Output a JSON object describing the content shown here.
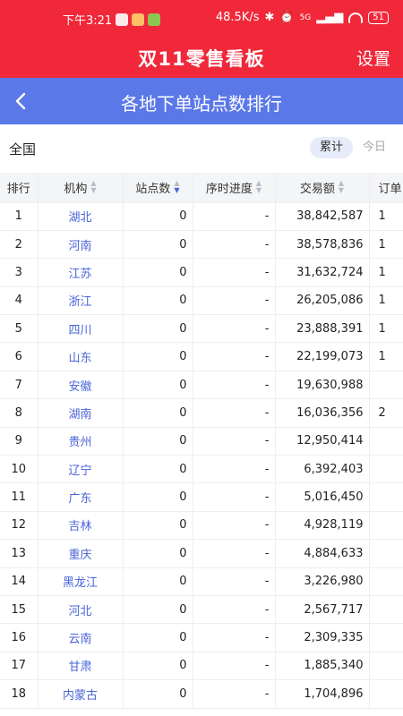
{
  "status_bar": {
    "time": "下午3:21",
    "speed": "48.5K/s",
    "signal": "5G",
    "battery": "51"
  },
  "header": {
    "title": "双11零售看板",
    "settings_label": "设置"
  },
  "subheader": {
    "title": "各地下单站点数排行"
  },
  "filter": {
    "region": "全国",
    "cumulative_label": "累计",
    "today_label": "今日"
  },
  "table": {
    "headers": {
      "rank": "排行",
      "org": "机构",
      "sites": "站点数",
      "progress": "序时进度",
      "amount": "交易额",
      "orders": "订单"
    },
    "rows": [
      {
        "rank": "1",
        "org": "湖北",
        "sites": "0",
        "progress": "-",
        "amount": "38,842,587",
        "orders": "1"
      },
      {
        "rank": "2",
        "org": "河南",
        "sites": "0",
        "progress": "-",
        "amount": "38,578,836",
        "orders": "1"
      },
      {
        "rank": "3",
        "org": "江苏",
        "sites": "0",
        "progress": "-",
        "amount": "31,632,724",
        "orders": "1"
      },
      {
        "rank": "4",
        "org": "浙江",
        "sites": "0",
        "progress": "-",
        "amount": "26,205,086",
        "orders": "1"
      },
      {
        "rank": "5",
        "org": "四川",
        "sites": "0",
        "progress": "-",
        "amount": "23,888,391",
        "orders": "1"
      },
      {
        "rank": "6",
        "org": "山东",
        "sites": "0",
        "progress": "-",
        "amount": "22,199,073",
        "orders": "1"
      },
      {
        "rank": "7",
        "org": "安徽",
        "sites": "0",
        "progress": "-",
        "amount": "19,630,988",
        "orders": ""
      },
      {
        "rank": "8",
        "org": "湖南",
        "sites": "0",
        "progress": "-",
        "amount": "16,036,356",
        "orders": "2"
      },
      {
        "rank": "9",
        "org": "贵州",
        "sites": "0",
        "progress": "-",
        "amount": "12,950,414",
        "orders": ""
      },
      {
        "rank": "10",
        "org": "辽宁",
        "sites": "0",
        "progress": "-",
        "amount": "6,392,403",
        "orders": ""
      },
      {
        "rank": "11",
        "org": "广东",
        "sites": "0",
        "progress": "-",
        "amount": "5,016,450",
        "orders": ""
      },
      {
        "rank": "12",
        "org": "吉林",
        "sites": "0",
        "progress": "-",
        "amount": "4,928,119",
        "orders": ""
      },
      {
        "rank": "13",
        "org": "重庆",
        "sites": "0",
        "progress": "-",
        "amount": "4,884,633",
        "orders": ""
      },
      {
        "rank": "14",
        "org": "黑龙江",
        "sites": "0",
        "progress": "-",
        "amount": "3,226,980",
        "orders": ""
      },
      {
        "rank": "15",
        "org": "河北",
        "sites": "0",
        "progress": "-",
        "amount": "2,567,717",
        "orders": ""
      },
      {
        "rank": "16",
        "org": "云南",
        "sites": "0",
        "progress": "-",
        "amount": "2,309,335",
        "orders": ""
      },
      {
        "rank": "17",
        "org": "甘肃",
        "sites": "0",
        "progress": "-",
        "amount": "1,885,340",
        "orders": ""
      },
      {
        "rank": "18",
        "org": "内蒙古",
        "sites": "0",
        "progress": "-",
        "amount": "1,704,896",
        "orders": ""
      }
    ]
  },
  "colors": {
    "header_red": "#f0283a",
    "subheader_blue": "#5b78e8",
    "link_blue": "#4a64d8"
  }
}
